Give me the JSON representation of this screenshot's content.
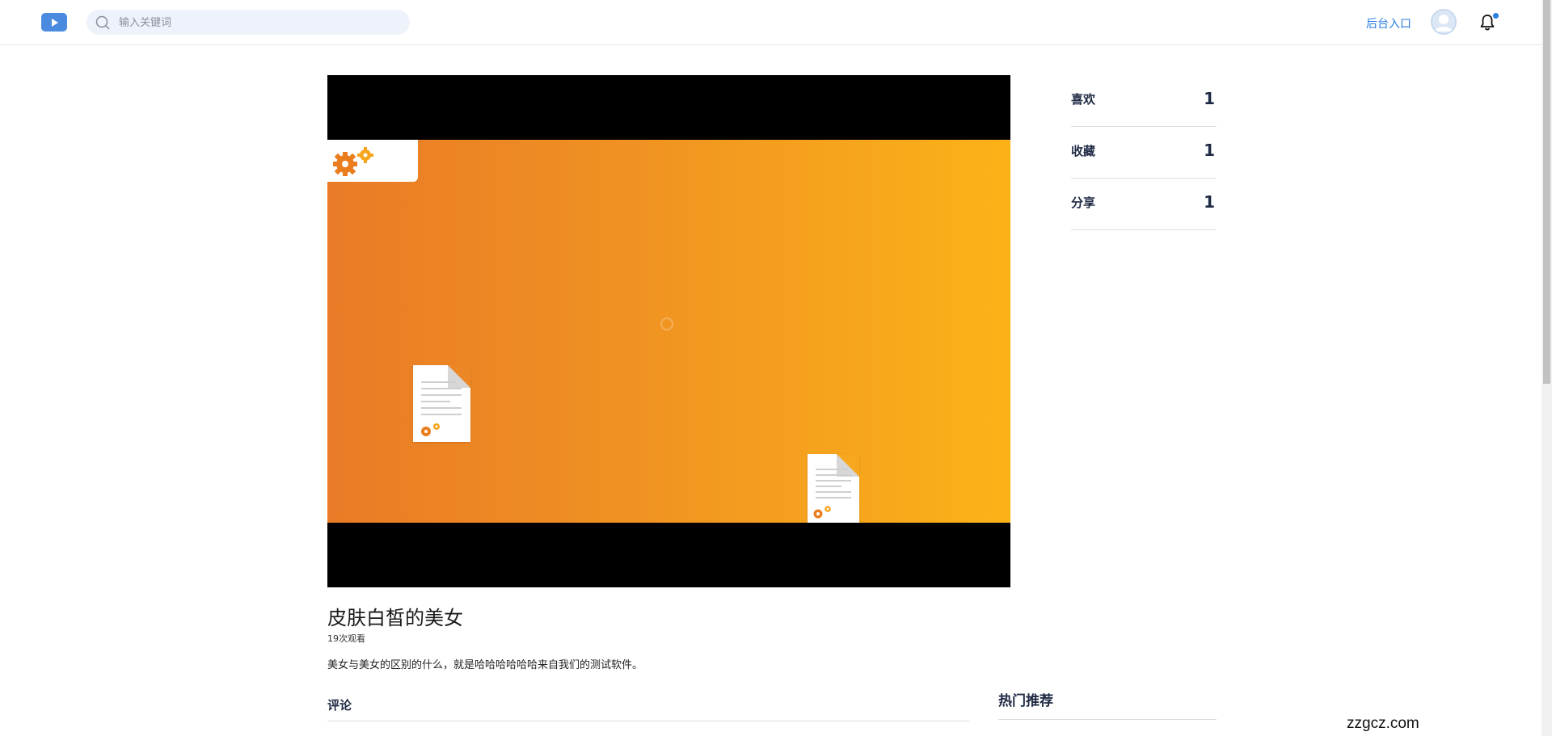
{
  "header": {
    "search_placeholder": "输入关键词",
    "admin_link": "后台入口",
    "accent_color": "#2a7de1",
    "logo_color": "#4a8be0",
    "icons": [
      "play-icon",
      "search-icon",
      "user-avatar-icon",
      "bell-icon"
    ]
  },
  "video": {
    "frame_gradient": [
      "#e97b26",
      "#fbb318"
    ],
    "icons": [
      "gears-icon",
      "document-icon"
    ]
  },
  "info": {
    "title": "皮肤白皙的美女",
    "views": "19次观看",
    "description": "美女与美女的区别的什么，就是哈哈哈哈哈哈来自我们的测试软件。"
  },
  "stats": [
    {
      "label": "喜欢",
      "value": "1"
    },
    {
      "label": "收藏",
      "value": "1"
    },
    {
      "label": "分享",
      "value": "1"
    }
  ],
  "comments": {
    "heading": "评论"
  },
  "hot": {
    "heading": "热门推荐"
  },
  "watermark": "zzgcz.com"
}
